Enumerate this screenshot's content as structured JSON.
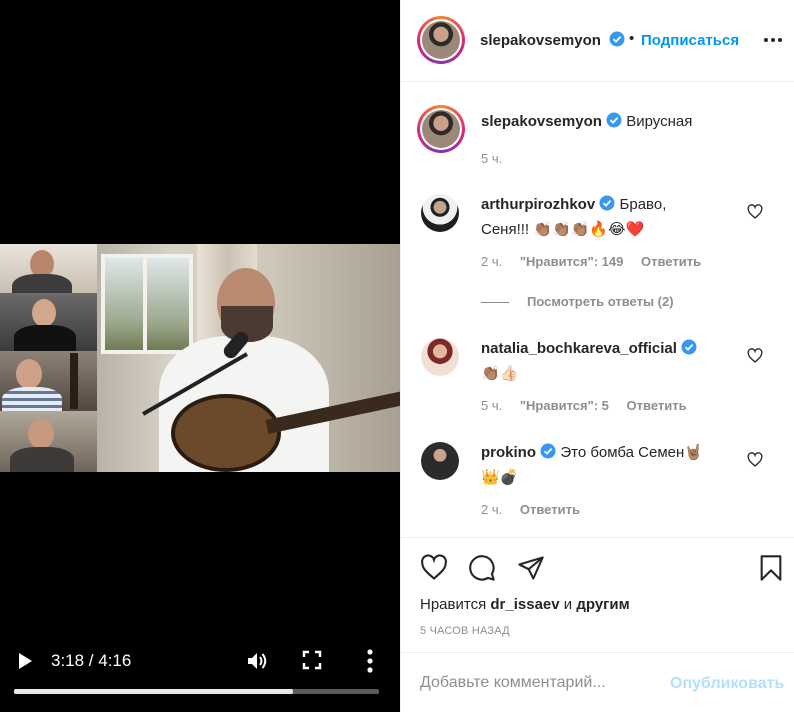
{
  "video": {
    "time": "3:18 / 4:16",
    "progress_fraction": 0.764,
    "icons": {
      "play": "play-icon",
      "volume": "volume-icon",
      "fullscreen": "fullscreen-icon",
      "more": "more-vertical-icon"
    }
  },
  "header": {
    "username": "slepakovsemyon",
    "separator": "•",
    "follow_label": "Подписаться"
  },
  "caption": {
    "username": "slepakovsemyon",
    "text": "Вирусная",
    "time": "5 ч."
  },
  "comments": [
    {
      "username": "arthurpirozhkov",
      "text": "Браво,",
      "text_line2": "Сеня!!!",
      "emoji": "👏🏽👏🏽👏🏽🔥😂❤️",
      "time": "2 ч.",
      "likes": "\"Нравится\": 149",
      "reply": "Ответить",
      "view_replies": "Посмотреть ответы (2)"
    },
    {
      "username": "natalia_bochkareva_official",
      "text": "",
      "emoji": "👏🏽👍🏻",
      "time": "5 ч.",
      "likes": "\"Нравится\": 5",
      "reply": "Ответить"
    },
    {
      "username": "prokino",
      "text": "Это бомба Семен🤘🏽",
      "emoji": "👑💣",
      "time": "2 ч.",
      "reply": "Ответить"
    }
  ],
  "actions": {
    "icons": [
      "heart-icon",
      "comment-icon",
      "share-icon",
      "bookmark-icon"
    ],
    "likes_prefix": "Нравится",
    "likes_user": "dr_issaev",
    "likes_and": "и",
    "likes_others": "другим",
    "time_ago": "5 ЧАСОВ НАЗАД"
  },
  "add_comment": {
    "placeholder": "Добавьте комментарий...",
    "post_label": "Опубликовать"
  },
  "colors": {
    "accent": "#0095f6",
    "post_disabled": "#b2dffc",
    "verified": "#3897f0",
    "like_red": "#ed4956"
  }
}
